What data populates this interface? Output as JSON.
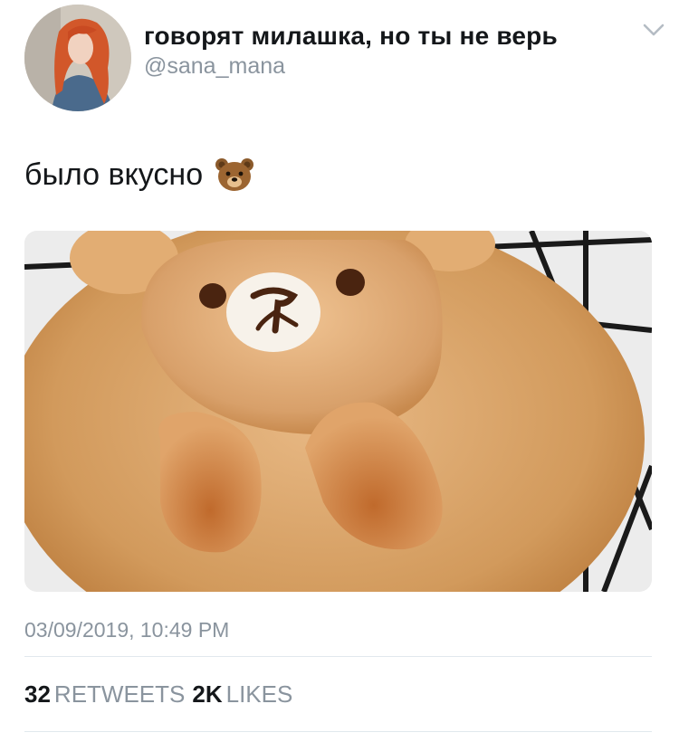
{
  "tweet": {
    "display_name": "говорят милашка, но ты не верь",
    "handle": "@sana_mana",
    "text": "было вкусно",
    "emoji": "bear-face",
    "timestamp": "03/09/2019, 10:49 PM",
    "stats": {
      "retweets_count": "32",
      "retweets_label": "RETWEETS",
      "likes_count": "2K",
      "likes_label": "LIKES"
    }
  },
  "icons": {
    "menu": "chevron-down-icon"
  },
  "colors": {
    "text_primary": "#14171a",
    "text_secondary": "#8a949e",
    "divider": "#e1e8ed"
  }
}
